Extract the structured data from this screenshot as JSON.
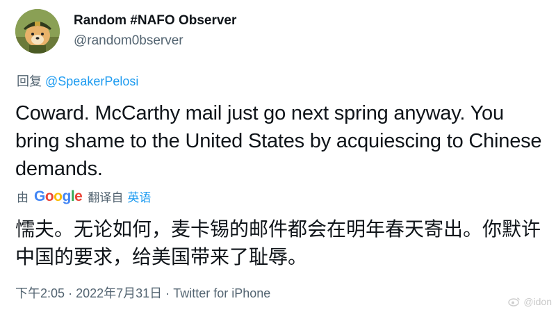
{
  "author": {
    "display_name": "Random #NAFO Observer",
    "handle": "@random0bserver"
  },
  "reply": {
    "prefix": "回复",
    "mention": "@SpeakerPelosi"
  },
  "tweet": {
    "text": "Coward. McCarthy mail just go next spring anyway. You bring shame to the United States by acquiescing to Chinese demands."
  },
  "translation": {
    "by_label": "由",
    "provider": "Google",
    "translated_from_label": "翻译自",
    "source_language": "英语",
    "text": "懦夫。无论如何，麦卡锡的邮件都会在明年春天寄出。你默许中国的要求，给美国带来了耻辱。"
  },
  "meta": {
    "time": "下午2:05",
    "date": "2022年7月31日",
    "source": "Twitter for iPhone",
    "separator": "·"
  },
  "watermark": {
    "text": "@idon"
  },
  "colors": {
    "link": "#1d9bf0",
    "secondary_text": "#536471",
    "primary_text": "#0f1419"
  }
}
